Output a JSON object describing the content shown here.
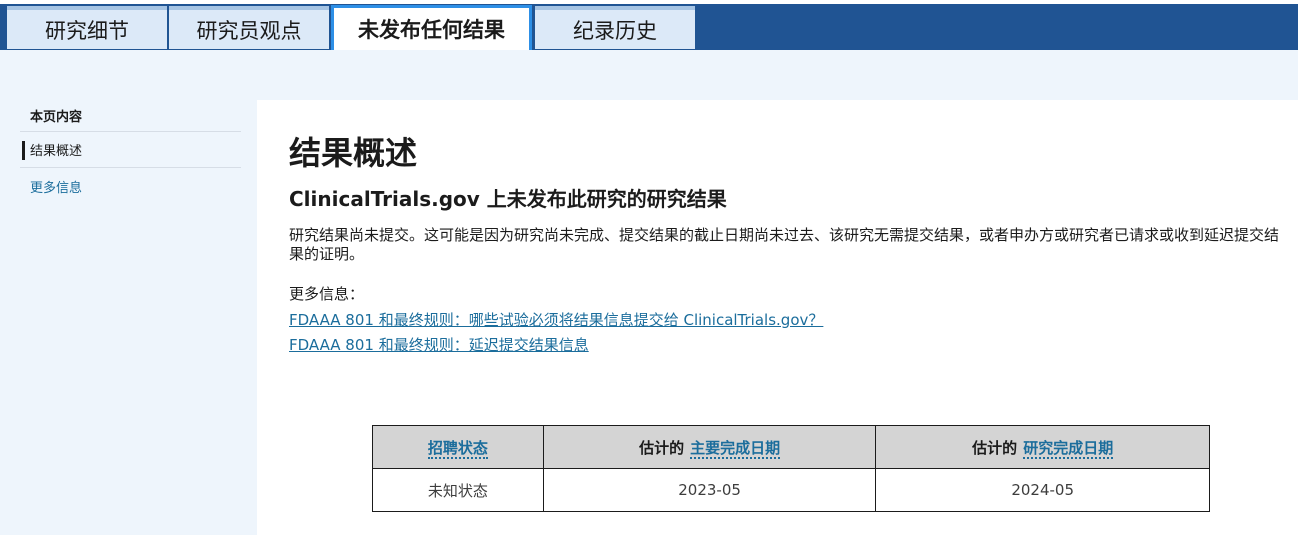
{
  "tabs": [
    {
      "label": "研究细节"
    },
    {
      "label": "研究员观点"
    },
    {
      "label": "未发布任何结果"
    },
    {
      "label": "纪录历史"
    }
  ],
  "sidebar": {
    "heading": "本页内容",
    "items": [
      {
        "label": "结果概述"
      },
      {
        "label": "更多信息"
      }
    ]
  },
  "main": {
    "title": "结果概述",
    "subtitle": "ClinicalTrials.gov 上未发布此研究的研究结果",
    "paragraph": "研究结果尚未提交。这可能是因为研究尚未完成、提交结果的截止日期尚未过去、该研究无需提交结果，或者申办方或研究者已请求或收到延迟提交结果的证明。",
    "more_info_label": "更多信息：",
    "links": [
      {
        "label": "FDAAA 801 和最终规则：哪些试验必须将结果信息提交给 ClinicalTrials.gov？"
      },
      {
        "label": "FDAAA 801 和最终规则：延迟提交结果信息"
      }
    ]
  },
  "status_table": {
    "headers": {
      "col1_term": "招聘状态",
      "col2_prefix": "估计的",
      "col2_term": "主要完成日期",
      "col3_prefix": "估计的",
      "col3_term": "研究完成日期"
    },
    "row": [
      "未知状态",
      "2023-05",
      "2024-05"
    ]
  }
}
